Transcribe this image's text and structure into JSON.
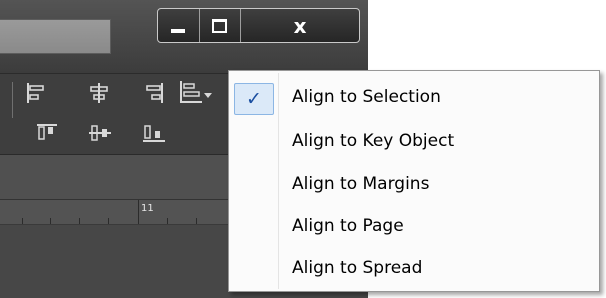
{
  "window": {
    "close_label": "x"
  },
  "ruler": {
    "label": "11"
  },
  "menu": {
    "check_glyph": "✓",
    "items": [
      {
        "label": "Align to Selection",
        "checked": true
      },
      {
        "label": "Align to Key Object",
        "checked": false
      },
      {
        "label": "Align to Margins",
        "checked": false
      },
      {
        "label": "Align to Page",
        "checked": false
      },
      {
        "label": "Align to Spread",
        "checked": false
      }
    ]
  },
  "toolbar": {
    "icons": [
      "align-left-edges-icon",
      "align-horizontal-centers-icon",
      "align-right-edges-icon",
      "align-to-dropdown-icon",
      "align-top-edges-icon",
      "align-vertical-centers-icon",
      "align-bottom-edges-icon"
    ]
  },
  "colors": {
    "window_bg": "#474747",
    "menu_bg": "#fbfbfb",
    "check_highlight": "#dbe9f8",
    "check_color": "#1a4ea0"
  }
}
